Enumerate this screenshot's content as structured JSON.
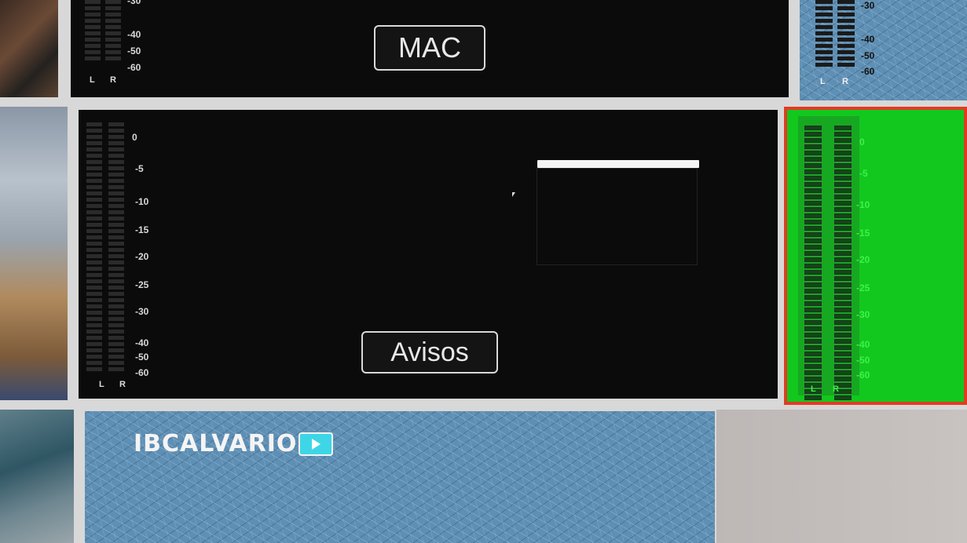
{
  "tiles": {
    "mac": {
      "label": "MAC"
    },
    "avisos": {
      "label": "Avisos"
    }
  },
  "logo": {
    "text": "IBCALVARIO"
  },
  "meter_labels": {
    "left": "L",
    "right": "R"
  },
  "scale_top_partial": [
    "-30",
    "-40",
    "-50",
    "-60"
  ],
  "scale_full": [
    "0",
    "-5",
    "-10",
    "-15",
    "-20",
    "-25",
    "-30",
    "-40",
    "-50",
    "-60"
  ],
  "colors": {
    "accent_active": "#e23b24",
    "meter_active": "#12c81e"
  }
}
